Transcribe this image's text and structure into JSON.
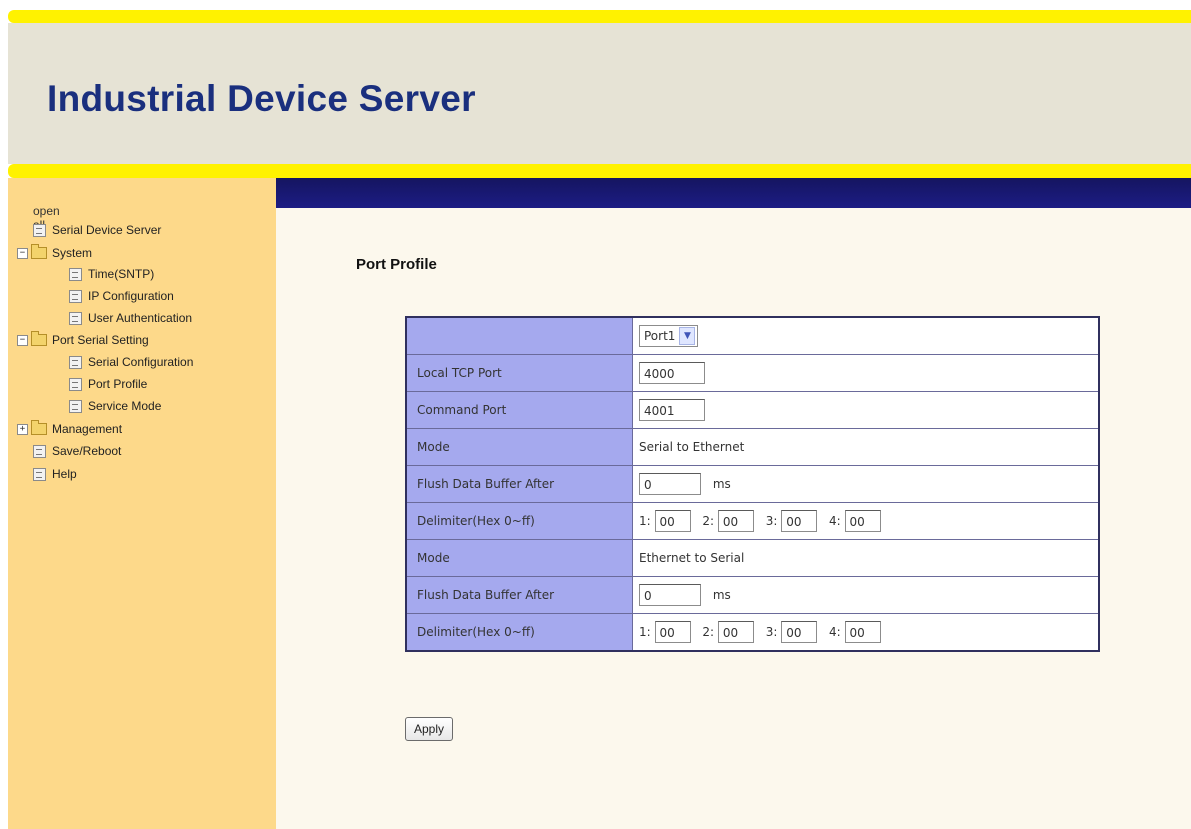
{
  "header": {
    "title": "Industrial Device Server"
  },
  "sidebar": {
    "open_all": "open all",
    "items": [
      {
        "label": "Serial Device Server"
      },
      {
        "label": "System",
        "expander": "−"
      },
      {
        "label": "Time(SNTP)"
      },
      {
        "label": "IP Configuration"
      },
      {
        "label": "User Authentication"
      },
      {
        "label": "Port Serial Setting",
        "expander": "−"
      },
      {
        "label": "Serial Configuration"
      },
      {
        "label": "Port Profile"
      },
      {
        "label": "Service Mode"
      },
      {
        "label": "Management",
        "expander": "+"
      },
      {
        "label": "Save/Reboot"
      },
      {
        "label": "Help"
      }
    ]
  },
  "main": {
    "page_title": "Port Profile",
    "port_select": {
      "value": "Port1",
      "arrow_icon": "chevron-down-icon"
    },
    "rows": {
      "local_tcp_port": {
        "label": "Local TCP Port",
        "value": "4000"
      },
      "command_port": {
        "label": "Command Port",
        "value": "4001"
      },
      "mode1": {
        "label": "Mode",
        "value": "Serial to Ethernet"
      },
      "flush1": {
        "label": "Flush Data Buffer After",
        "value": "0",
        "unit": "ms"
      },
      "delim1": {
        "label": "Delimiter(Hex 0~ff)",
        "values": [
          "00",
          "00",
          "00",
          "00"
        ],
        "labels": [
          "1:",
          "2:",
          "3:",
          "4:"
        ]
      },
      "mode2": {
        "label": "Mode",
        "value": "Ethernet to Serial"
      },
      "flush2": {
        "label": "Flush Data Buffer After",
        "value": "0",
        "unit": "ms"
      },
      "delim2": {
        "label": "Delimiter(Hex 0~ff)",
        "values": [
          "00",
          "00",
          "00",
          "00"
        ],
        "labels": [
          "1:",
          "2:",
          "3:",
          "4:"
        ]
      }
    },
    "apply_label": "Apply"
  },
  "colors": {
    "yellow_band": "#fff200",
    "header_bg": "#e6e3d5",
    "title_blue": "#1a2f7e",
    "sidebar_bg": "#fdd98a",
    "navbar": "#1a1a70",
    "label_cell": "#a5a9ee",
    "content_bg": "#fcf8ed"
  }
}
